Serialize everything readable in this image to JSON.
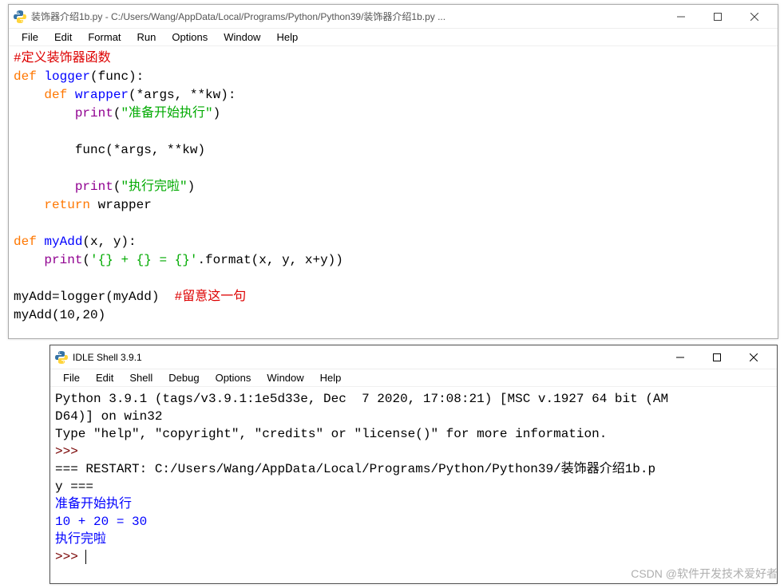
{
  "editor": {
    "title": "装饰器介绍1b.py - C:/Users/Wang/AppData/Local/Programs/Python/Python39/装饰器介绍1b.py ...",
    "menu": [
      "File",
      "Edit",
      "Format",
      "Run",
      "Options",
      "Window",
      "Help"
    ],
    "code": {
      "l1_comment": "#定义装饰器函数",
      "l2_def": "def",
      "l2_name": " logger",
      "l2_rest": "(func):",
      "l3_indent": "    ",
      "l3_def": "def",
      "l3_name": " wrapper",
      "l3_rest": "(*args, **kw):",
      "l4_indent": "        ",
      "l4_print": "print",
      "l4_paren": "(",
      "l4_str": "\"准备开始执行\"",
      "l4_close": ")",
      "l6_indent": "        ",
      "l6_text": "func(*args, **kw)",
      "l8_indent": "        ",
      "l8_print": "print",
      "l8_paren": "(",
      "l8_str": "\"执行完啦\"",
      "l8_close": ")",
      "l9_indent": "    ",
      "l9_return": "return",
      "l9_rest": " wrapper",
      "l11_def": "def",
      "l11_name": " myAdd",
      "l11_rest": "(x, y):",
      "l12_indent": "    ",
      "l12_print": "print",
      "l12_paren": "(",
      "l12_str": "'{} + {} = {}'",
      "l12_format": ".format(x, y, x+y))",
      "l14_text": "myAdd=logger(myAdd)  ",
      "l14_comment": "#留意这一句",
      "l15_text": "myAdd(10,20)"
    }
  },
  "shell": {
    "title": "IDLE Shell 3.9.1",
    "menu": [
      "File",
      "Edit",
      "Shell",
      "Debug",
      "Options",
      "Window",
      "Help"
    ],
    "banner1": "Python 3.9.1 (tags/v3.9.1:1e5d33e, Dec  7 2020, 17:08:21) [MSC v.1927 64 bit (AM",
    "banner2": "D64)] on win32",
    "banner3": "Type \"help\", \"copyright\", \"credits\" or \"license()\" for more information.",
    "prompt": ">>>",
    "restart1": "=== RESTART: C:/Users/Wang/AppData/Local/Programs/Python/Python39/装饰器介绍1b.p",
    "restart2": "y ===",
    "out1": "准备开始执行",
    "out2": "10 + 20 = 30",
    "out3": "执行完啦"
  },
  "watermark": "CSDN @软件开发技术爱好者"
}
